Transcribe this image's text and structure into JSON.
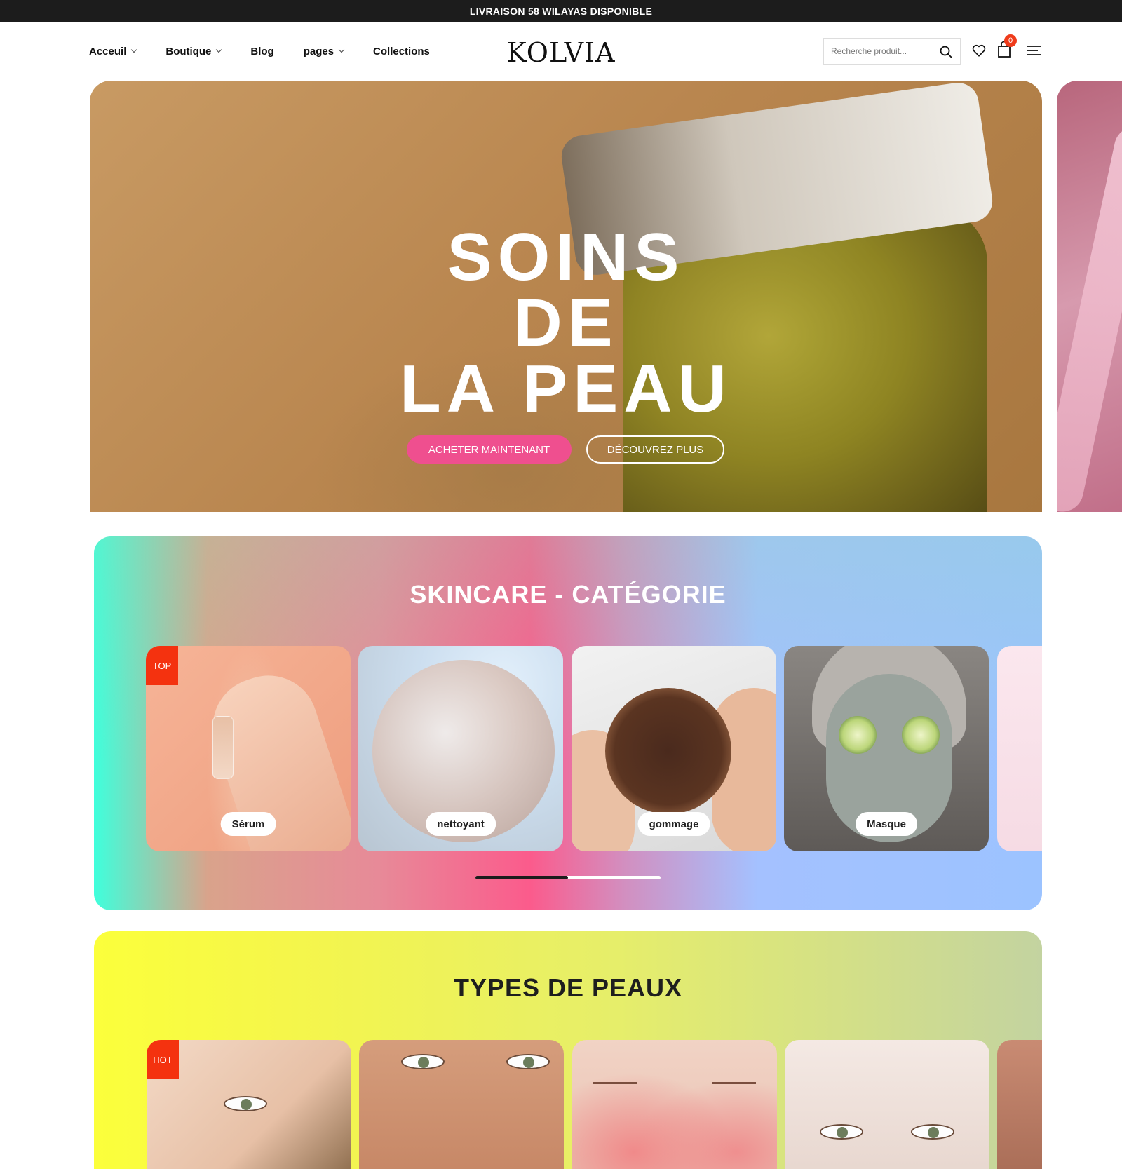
{
  "announcement": "LIVRAISON 58 WILAYAS DISPONIBLE",
  "nav": {
    "items": [
      {
        "label": "Acceuil",
        "has_dropdown": true
      },
      {
        "label": "Boutique",
        "has_dropdown": true
      },
      {
        "label": "Blog",
        "has_dropdown": false
      },
      {
        "label": "pages",
        "has_dropdown": true
      },
      {
        "label": "Collections",
        "has_dropdown": false
      }
    ]
  },
  "logo": "KOLVIA",
  "search": {
    "placeholder": "Recherche produit..."
  },
  "header_icons": [
    "search-icon",
    "heart-icon",
    "shopping-bag-icon",
    "menu-icon"
  ],
  "cart": {
    "count": "0"
  },
  "hero": {
    "title": "SOINS\nDE\nLA PEAU",
    "primary_button": "ACHETER MAINTENANT",
    "secondary_button": "DÉCOUVREZ PLUS"
  },
  "skincare": {
    "title": "SKINCARE - CATÉGORIE",
    "cards": [
      {
        "label": "Sérum",
        "tag": "TOP"
      },
      {
        "label": "nettoyant"
      },
      {
        "label": "gommage"
      },
      {
        "label": "Masque"
      }
    ],
    "scroll_progress": 0.5
  },
  "skin_types": {
    "title": "TYPES DE PEAUX",
    "cards": [
      {
        "tag": "HOT"
      }
    ]
  },
  "colors": {
    "accent_pink": "#ef4f8f",
    "tag_red": "#f4320f",
    "topbar": "#1c1c1c"
  }
}
